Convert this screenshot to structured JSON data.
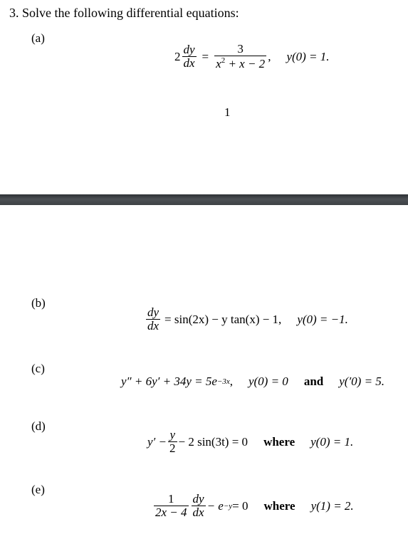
{
  "heading": "3.  Solve the following differential equations:",
  "page_number": "1",
  "parts": [
    {
      "label": "(a)",
      "equation": {
        "coef": "2",
        "lhs_num": "dy",
        "lhs_den": "dx",
        "eq": "=",
        "rhs_num": "3",
        "rhs_den_1": "x",
        "rhs_den_sup": "2",
        "rhs_den_2": " + x − 2",
        "comma": ",",
        "condition": "y(0) = 1."
      }
    },
    {
      "label": "(b)",
      "equation": {
        "lhs_num": "dy",
        "lhs_den": "dx",
        "rhs": "= sin(2x) − y tan(x) − 1,",
        "condition": "y(0) = −1."
      }
    },
    {
      "label": "(c)",
      "equation": {
        "lhs": "y″ + 6y′ + 34y = 5e",
        "sup": "−3x",
        "comma": ",",
        "condition1": "y(0) = 0",
        "connector": "and",
        "condition2": "y(′0) = 5."
      }
    },
    {
      "label": "(d)",
      "equation": {
        "lhs": "y′ −",
        "frac_num": "y",
        "frac_den": "2",
        "rest": "− 2 sin(3t) = 0",
        "connector": "where",
        "condition": "y(0) = 1."
      }
    },
    {
      "label": "(e)",
      "equation": {
        "frac1_num": "1",
        "frac1_den": "2x − 4",
        "frac2_num": "dy",
        "frac2_den": "dx",
        "rest_1": "− e",
        "sup": "−y",
        "rest_2": " = 0",
        "connector": "where",
        "condition": "y(1) = 2."
      }
    }
  ]
}
